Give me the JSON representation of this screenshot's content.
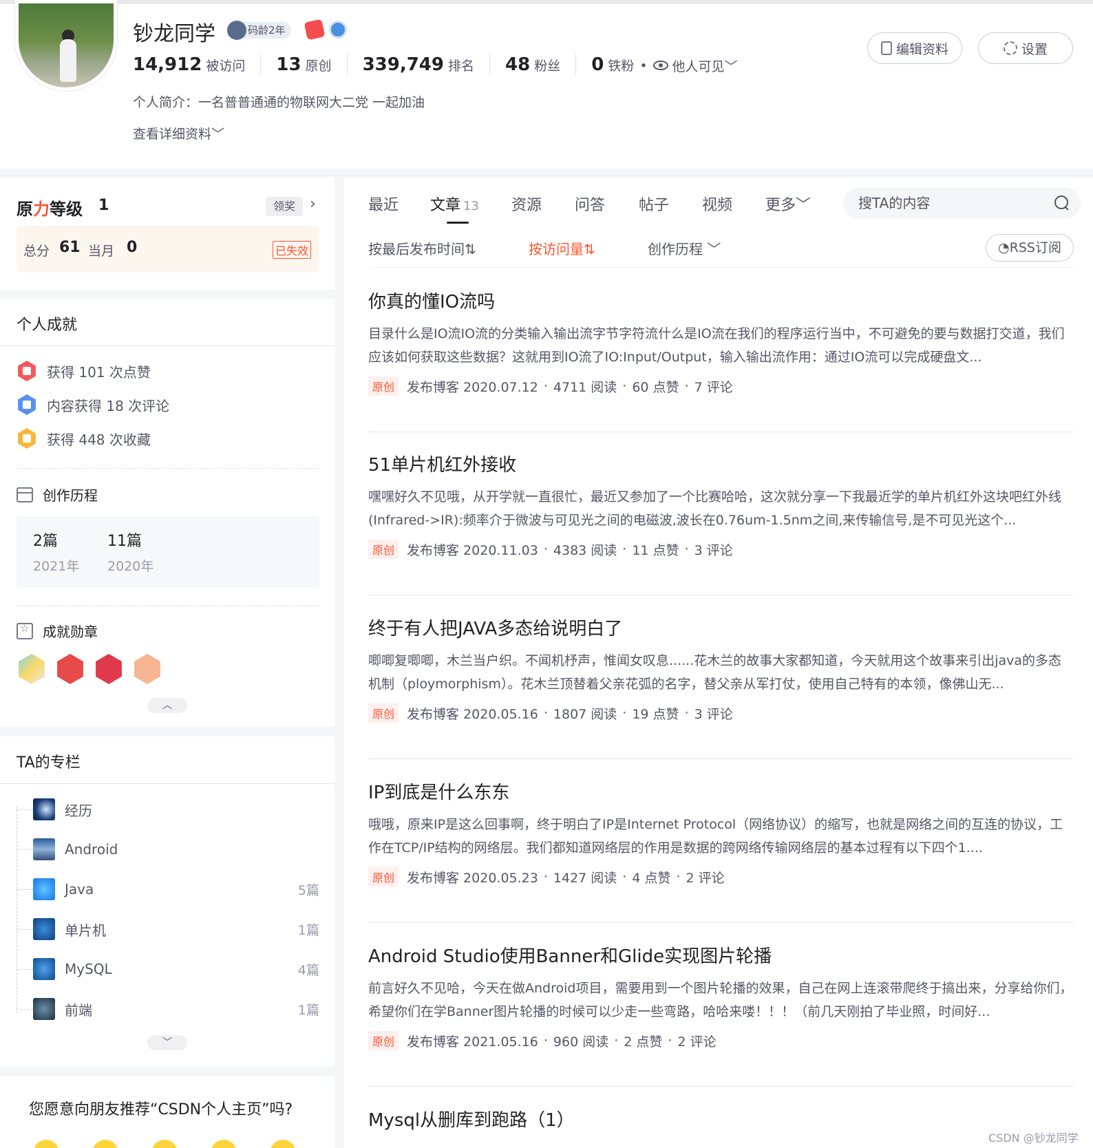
{
  "profile": {
    "nickname": "钞龙同学",
    "age_badge": "码龄2年",
    "stats": [
      {
        "num": "14,912",
        "label": "被访问"
      },
      {
        "num": "13",
        "label": "原创"
      },
      {
        "num": "339,749",
        "label": "排名"
      },
      {
        "num": "48",
        "label": "粉丝"
      },
      {
        "num": "0",
        "label": "铁粉"
      }
    ],
    "visibility": "他人可见﹀",
    "intro": "个人简介：一名普普通通的物联网大二党 一起加油",
    "detail_link": "查看详细资料﹀",
    "edit_label": "编辑资料",
    "settings_label": "设置"
  },
  "level": {
    "title_a": "原",
    "title_b": "力",
    "title_c": "等级",
    "value": "1",
    "claim_label": "领奖",
    "arrow": "›",
    "total_label": "总分",
    "total": "61",
    "month_label": "当月",
    "month": "0",
    "status": "已失效"
  },
  "achievements": {
    "title": "个人成就",
    "items": [
      {
        "text": "获得 101 次点赞",
        "color": "#f4585b"
      },
      {
        "text": "内容获得 18 次评论",
        "color": "#5b8ff0"
      },
      {
        "text": "获得 448 次收藏",
        "color": "#f6b73c"
      }
    ],
    "history_title": "创作历程",
    "history": [
      {
        "count": "2篇",
        "year": "2021年"
      },
      {
        "count": "11篇",
        "year": "2020年"
      }
    ],
    "medals_title": "成就勋章",
    "collapse_up": "︿"
  },
  "columns": {
    "title": "TA的专栏",
    "items": [
      {
        "name": "经历",
        "count": ""
      },
      {
        "name": "Android",
        "count": ""
      },
      {
        "name": "Java",
        "count": "5篇"
      },
      {
        "name": "单片机",
        "count": "1篇"
      },
      {
        "name": "MySQL",
        "count": "4篇"
      },
      {
        "name": "前端",
        "count": "1篇"
      }
    ],
    "expand_down": "﹀"
  },
  "recommend": {
    "question": "您愿意向朋友推荐“CSDN个人主页”吗?"
  },
  "tabs": [
    {
      "label": "最近",
      "count": ""
    },
    {
      "label": "文章",
      "count": "13"
    },
    {
      "label": "资源",
      "count": ""
    },
    {
      "label": "问答",
      "count": ""
    },
    {
      "label": "帖子",
      "count": ""
    },
    {
      "label": "视频",
      "count": ""
    },
    {
      "label": "更多﹀",
      "count": ""
    }
  ],
  "search": {
    "placeholder": "搜TA的内容"
  },
  "sort": {
    "by_time": "按最后发布时间⇅",
    "by_views": "按访问量⇅",
    "history": "创作历程 ﹀",
    "rss": "RSS订阅"
  },
  "articles": [
    {
      "title": "你真的懂IO流吗",
      "desc": "目录什么是IO流IO流的分类输入输出流字节字符流什么是IO流在我们的程序运行当中，不可避免的要与数据打交道，我们应该如何获取这些数据？这就用到IO流了IO:Input/Output，输入输出流作用：通过IO流可以完成硬盘文...",
      "tag": "原创",
      "date": "发布博客 2020.07.12",
      "reads": "4711 阅读",
      "likes": "60 点赞",
      "comments": "7 评论"
    },
    {
      "title": "51单片机红外接收",
      "desc": "嘿嘿好久不见哦，从开学就一直很忙，最近又参加了一个比赛哈哈，这次就分享一下我最近学的单片机红外这块吧红外线(Infrared->IR):频率介于微波与可见光之间的电磁波,波长在0.76um-1.5nm之间,来传输信号,是不可见光这个...",
      "tag": "原创",
      "date": "发布博客 2020.11.03",
      "reads": "4383 阅读",
      "likes": "11 点赞",
      "comments": "3 评论"
    },
    {
      "title": "终于有人把JAVA多态给说明白了",
      "desc": "唧唧复唧唧，木兰当户织。不闻机杼声，惟闻女叹息......花木兰的故事大家都知道，今天就用这个故事来引出java的多态机制（ploymorphism）。花木兰顶替着父亲花弧的名字，替父亲从军打仗，使用自己特有的本领，像佛山无...",
      "tag": "原创",
      "date": "发布博客 2020.05.16",
      "reads": "1807 阅读",
      "likes": "19 点赞",
      "comments": "3 评论"
    },
    {
      "title": "IP到底是什么东东",
      "desc": "哦哦，原来IP是这么回事啊，终于明白了IP是Internet Protocol（网络协议）的缩写，也就是网络之间的互连的协议，工作在TCP/IP结构的网络层。我们都知道网络层的作用是数据的跨网络传输网络层的基本过程有以下四个1....",
      "tag": "原创",
      "date": "发布博客 2020.05.23",
      "reads": "1427 阅读",
      "likes": "4 点赞",
      "comments": "2 评论"
    },
    {
      "title": "Android Studio使用Banner和Glide实现图片轮播",
      "desc": "前言好久不见哈，今天在做Android项目，需要用到一个图片轮播的效果，自己在网上连滚带爬终于搞出来，分享给你们，希望你们在学Banner图片轮播的时候可以少走一些弯路，哈哈来喽！！！（前几天刚拍了毕业照，时间好...",
      "tag": "原创",
      "date": "发布博客 2021.05.16",
      "reads": "960 阅读",
      "likes": "2 点赞",
      "comments": "2 评论"
    },
    {
      "title": "Mysql从删库到跑路（1）",
      "desc": "",
      "tag": "",
      "date": "",
      "reads": "",
      "likes": "",
      "comments": ""
    }
  ],
  "watermark": "CSDN @钞龙同学"
}
